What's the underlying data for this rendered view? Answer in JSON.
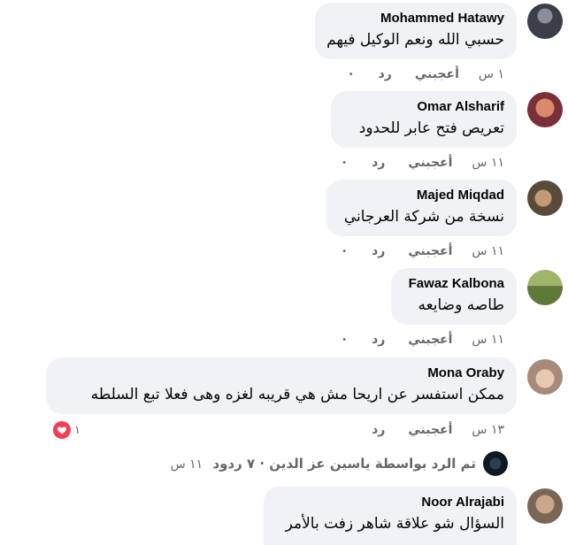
{
  "comments": [
    {
      "name": "Mohammed Hatawy",
      "text": "حسبي الله ونعم الوكيل فيهم",
      "time": "١ س",
      "like": "أعجبني",
      "reply": "رد",
      "dot": "•"
    },
    {
      "name": "Omar Alsharif",
      "text": "تعريص فتح عابر للحدود",
      "time": "١١ س",
      "like": "أعجبني",
      "reply": "رد",
      "dot": "•"
    },
    {
      "name": "Majed Miqdad",
      "text": "نسخة من شركة العرجاني",
      "time": "١١ س",
      "like": "أعجبني",
      "reply": "رد",
      "dot": "•"
    },
    {
      "name": "Fawaz Kalbona",
      "text": "طاصه وضايعه",
      "time": "١١ س",
      "like": "أعجبني",
      "reply": "رد",
      "dot": "•"
    },
    {
      "name": "Mona Oraby",
      "text": "ممكن استفسر عن اريحا مش هي قريبه لغزه وهى فعلا تبع السلطه",
      "time": "١٣ س",
      "like": "أعجبني",
      "reply": "رد",
      "reaction_count": "١",
      "replies": {
        "label": "تم الرد بواسطة ياسين عز الدين · ٧ ردود",
        "time": "١١ س"
      }
    },
    {
      "name": "Noor Alrajabi",
      "text": "السؤال شو علاقة شاهر زفت بالأمر"
    }
  ],
  "colors": {
    "bubble": "#f0f2f5",
    "secondary_text": "#65676b",
    "heart": "#f33e58"
  }
}
